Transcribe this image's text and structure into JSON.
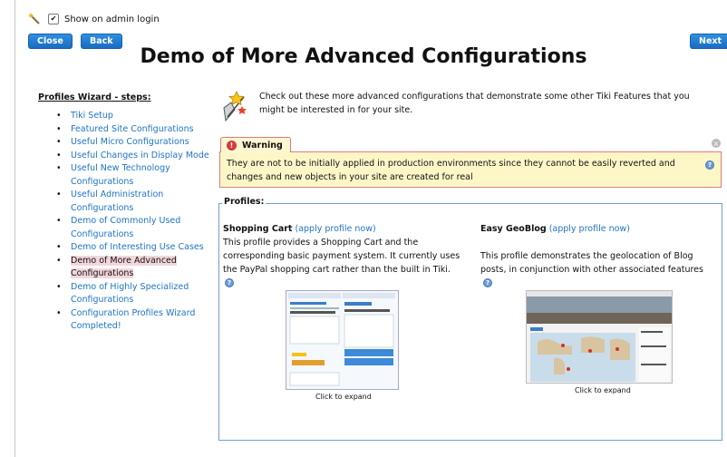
{
  "topbar": {
    "show_on_admin_login": "Show on admin login",
    "checked_mark": "✔"
  },
  "buttons": {
    "close": "Close",
    "back": "Back",
    "next": "Next"
  },
  "page_title": "Demo of More Advanced Configurations",
  "sidebar": {
    "heading": "Profiles Wizard - steps:",
    "steps": [
      "Tiki Setup",
      "Featured Site Configurations",
      "Useful Micro Configurations",
      "Useful Changes in Display Mode",
      "Useful New Technology Configurations",
      "Useful Administration Configurations",
      "Demo of Commonly Used Configurations",
      "Demo of Interesting Use Cases",
      "Demo of More Advanced Configurations",
      "Demo of Highly Specialized Configurations",
      "Configuration Profiles Wizard Completed!"
    ]
  },
  "intro_text": "Check out these more advanced configurations that demonstrate some other Tiki Features that you might be interested in for your site.",
  "warning": {
    "title": "Warning",
    "icon": "!",
    "text": "They are not to be initially applied in production environments since they cannot be easily reverted and changes and new objects in your site are created for real"
  },
  "profiles": {
    "legend": "Profiles:",
    "items": [
      {
        "name": "Shopping Cart",
        "apply_link": "(apply profile now)",
        "description": "This profile provides a Shopping Cart and the corresponding basic payment system. It currently uses the PayPal shopping cart rather than the built in Tiki.",
        "caption": "Click to expand"
      },
      {
        "name": "Easy GeoBlog",
        "apply_link": "(apply profile now)",
        "description": "This profile demonstrates the geolocation of Blog posts, in conjunction with other associated features",
        "caption": "Click to expand"
      }
    ]
  },
  "icons": {
    "help": "?",
    "close": "×"
  }
}
